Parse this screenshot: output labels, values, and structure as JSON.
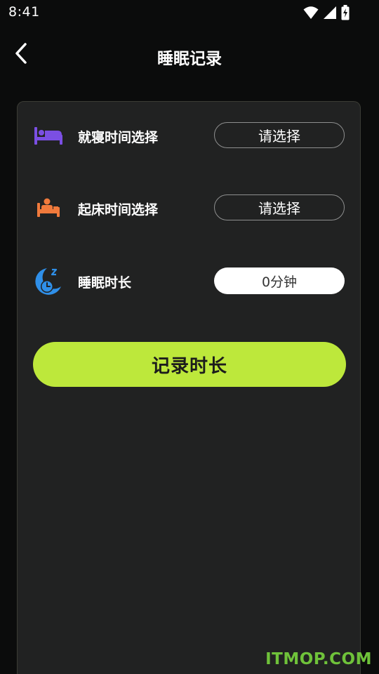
{
  "status_bar": {
    "time": "8:41",
    "icons": [
      "wifi-icon",
      "signal-icon",
      "battery-icon"
    ]
  },
  "header": {
    "title": "睡眠记录",
    "back_icon": "back-arrow-icon"
  },
  "rows": [
    {
      "label": "就寝时间选择",
      "icon": "bed-icon",
      "icon_color": "#7b4fe3",
      "value": "请选择"
    },
    {
      "label": "起床时间选择",
      "icon": "wake-up-bed-icon",
      "icon_color": "#f07a3c",
      "value": "请选择"
    },
    {
      "label": "睡眠时长",
      "icon": "sleep-clock-icon",
      "icon_color": "#2f8fe8",
      "value": "0分钟"
    }
  ],
  "record_button": {
    "label": "记录时长"
  },
  "watermark": "ITMOP.COM",
  "colors": {
    "background": "#0b0c0c",
    "card": "#212222",
    "accent": "#bde83b",
    "watermark": "#6fc23a"
  }
}
